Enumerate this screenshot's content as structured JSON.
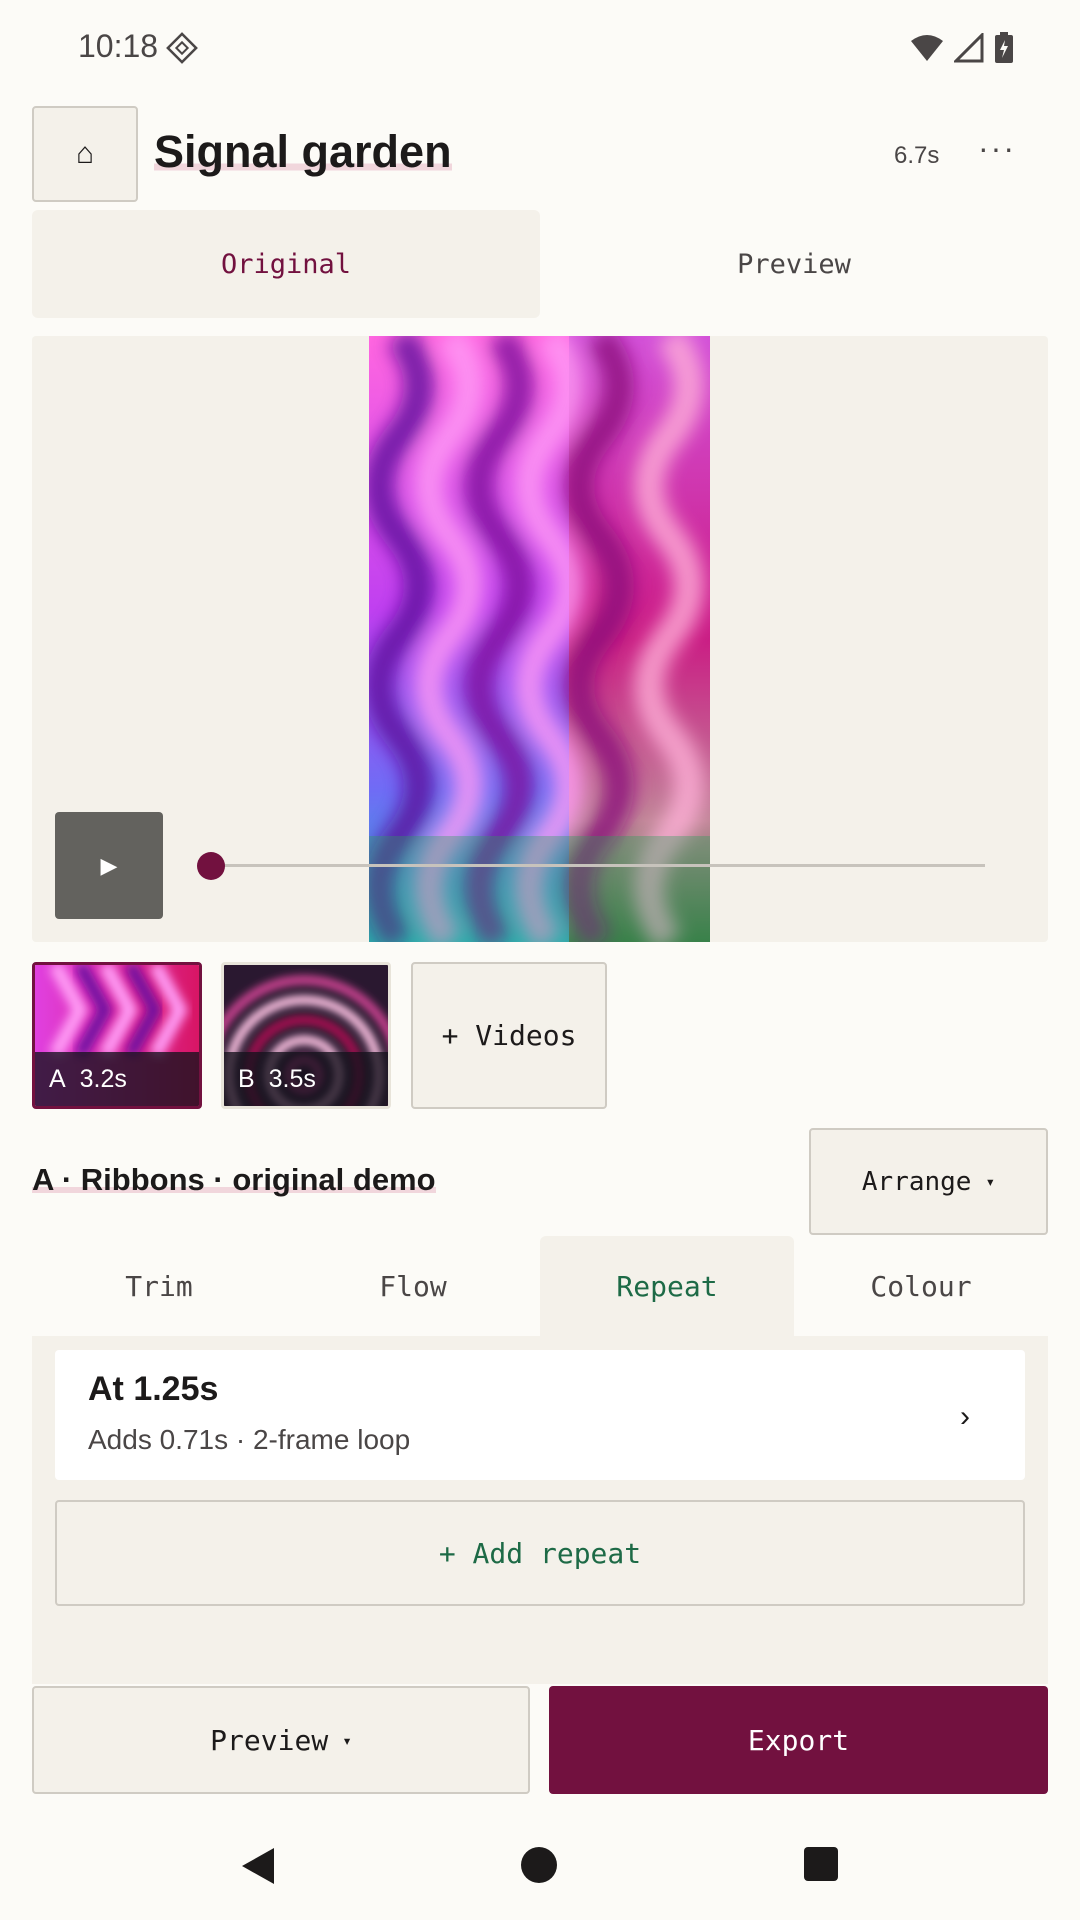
{
  "status_bar": {
    "time": "10:18",
    "icons": [
      "developer-mode-icon",
      "wifi-icon",
      "cellular-signal-icon",
      "battery-charging-icon"
    ]
  },
  "header": {
    "home_icon": "home-icon",
    "home_glyph": "⌂",
    "title": "Signal garden",
    "duration": "6.7s",
    "more_glyph": "···"
  },
  "view_toggle": {
    "options": [
      "Original",
      "Preview"
    ],
    "selected": "Original"
  },
  "player": {
    "play_glyph": "▶",
    "progress": 0.0
  },
  "clips": [
    {
      "letter": "A",
      "duration": "3.2s",
      "selected": true
    },
    {
      "letter": "B",
      "duration": "3.5s",
      "selected": false
    }
  ],
  "add_videos_label": "+ Videos",
  "section": {
    "title": "A · Ribbons · original demo",
    "arrange_label": "Arrange",
    "caret": "▾"
  },
  "tabs": {
    "items": [
      "Trim",
      "Flow",
      "Repeat",
      "Colour"
    ],
    "selected": "Repeat"
  },
  "repeat_panel": {
    "items": [
      {
        "title": "At 1.25s",
        "subtitle": "Adds 0.71s · 2-frame loop",
        "chevron": "›"
      }
    ],
    "add_label": "+ Add repeat"
  },
  "actions": {
    "preview_label": "Preview",
    "export_label": "Export"
  },
  "colors": {
    "accent": "#72113f",
    "positive": "#1d6a46",
    "surface": "#f4f1ea",
    "background": "#fcfbf7"
  }
}
